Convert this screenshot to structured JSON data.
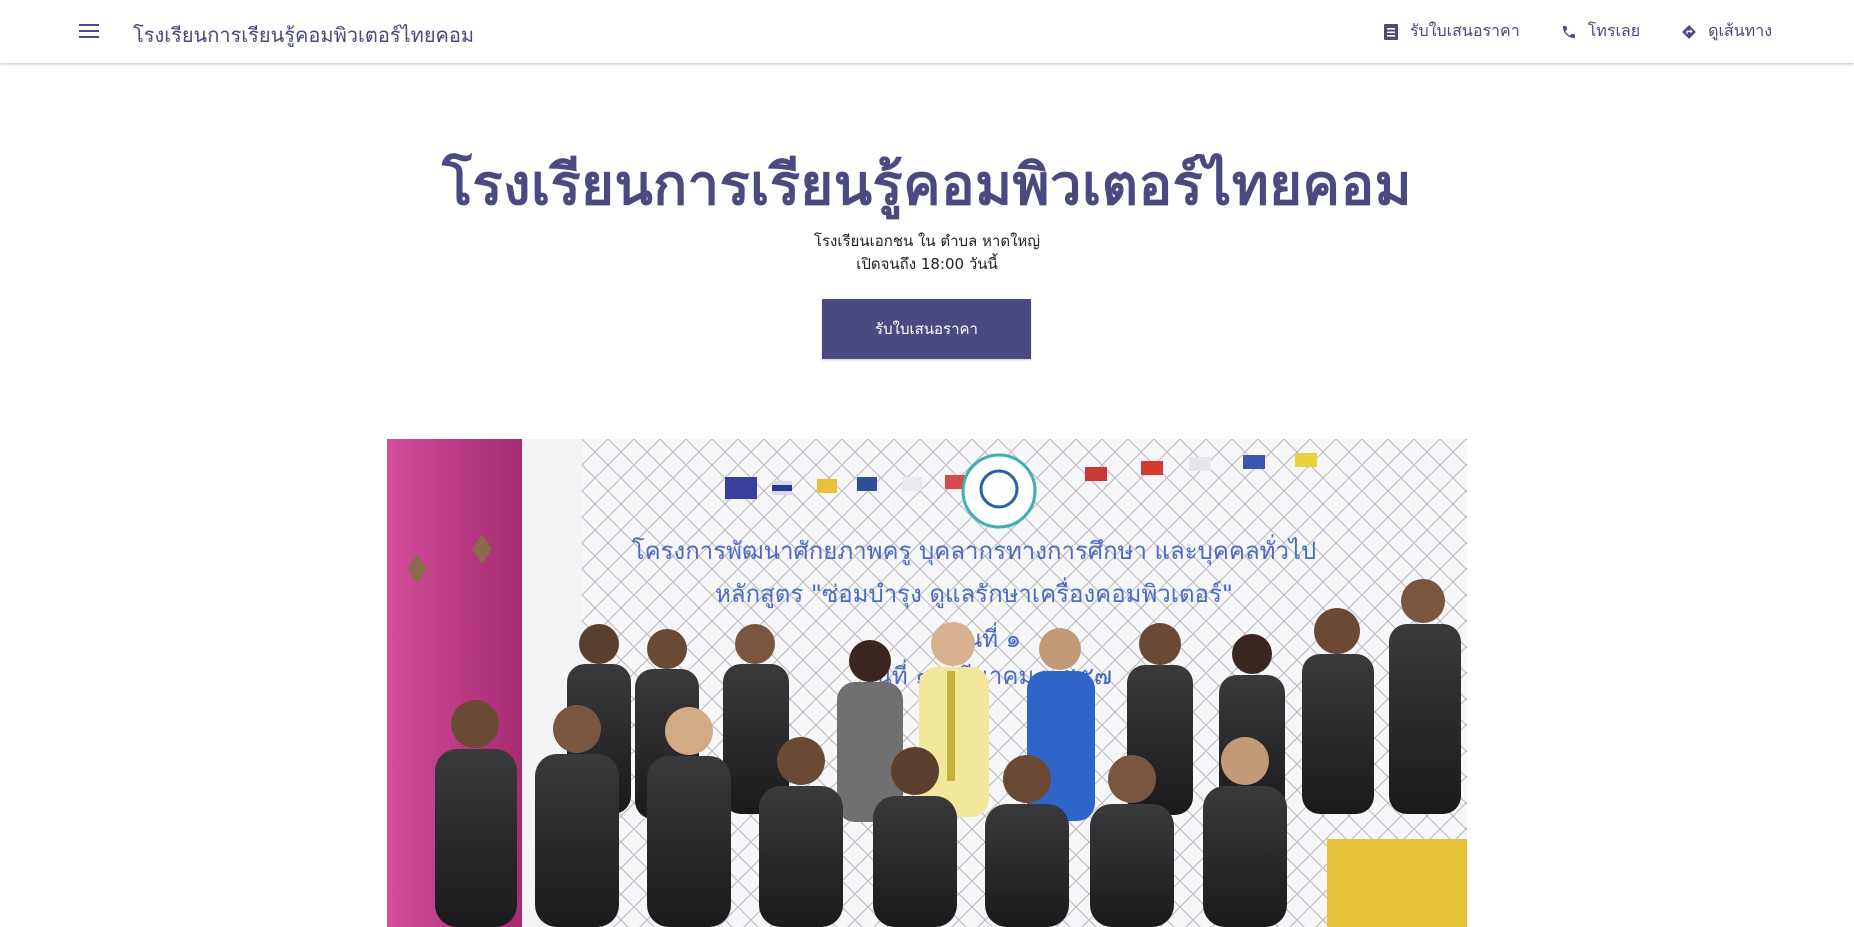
{
  "header": {
    "site_name": "โรงเรียนการเรียนรู้คอมพิวเตอร์ไทยคอม",
    "menu_icon": "menu-icon",
    "actions": [
      {
        "label": "รับใบเสนอราคา",
        "icon": "quote-icon"
      },
      {
        "label": "โทรเลย",
        "icon": "phone-icon"
      },
      {
        "label": "ดูเส้นทาง",
        "icon": "directions-icon"
      }
    ]
  },
  "hero": {
    "title": "โรงเรียนการเรียนรู้คอมพิวเตอร์ไทยคอม",
    "subtitle_line1": "โรงเรียนเอกชน ใน ตำบล หาดใหญ่",
    "subtitle_line2": "เปิดจนถึง 18:00 วันนี้",
    "cta_label": "รับใบเสนอราคา"
  },
  "photo": {
    "banner_line1": "โครงการพัฒนาศักยภาพครู บุคลากรทางการศึกษา และบุคคลทั่วไป",
    "banner_line2": "หลักสูตร \"ซ่อมบำรุง ดูแลรักษาเครื่องคอมพิวเตอร์\"",
    "banner_line3": "รุ่นที่ ๑",
    "banner_line4": "วันที่ ๑๘ มีนาคม ๒๕๕๗"
  },
  "colors": {
    "brand": "#4a4a80",
    "background": "#ffffff"
  }
}
